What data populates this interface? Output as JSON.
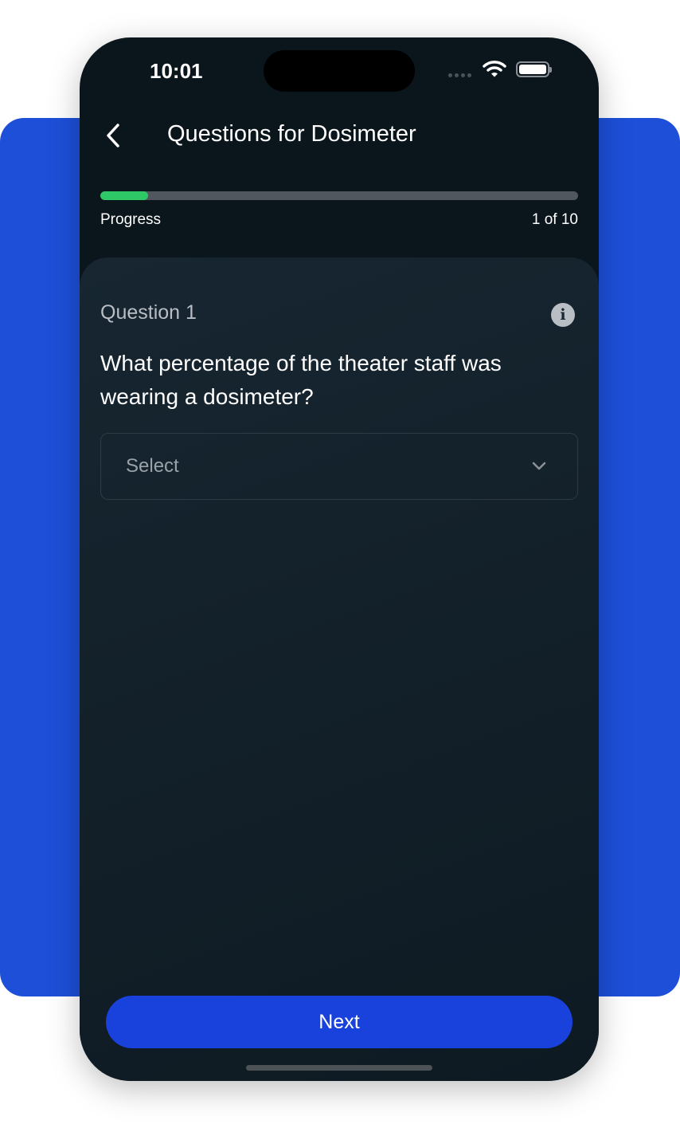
{
  "status_bar": {
    "time": "10:01"
  },
  "header": {
    "title": "Questions for Dosimeter",
    "back_icon": "chevron-left-icon"
  },
  "progress": {
    "label": "Progress",
    "count_text": "1 of 10",
    "current": 1,
    "total": 10,
    "fill_color": "#2ec866"
  },
  "question": {
    "number_label": "Question 1",
    "text": "What percentage of the theater staff was wearing a dosimeter?",
    "info_icon": "i"
  },
  "answer_select": {
    "placeholder": "Select"
  },
  "footer": {
    "next_label": "Next"
  },
  "colors": {
    "accent": "#1941db",
    "background_panel": "#1d4fd8",
    "phone_bg": "#0b151c"
  }
}
